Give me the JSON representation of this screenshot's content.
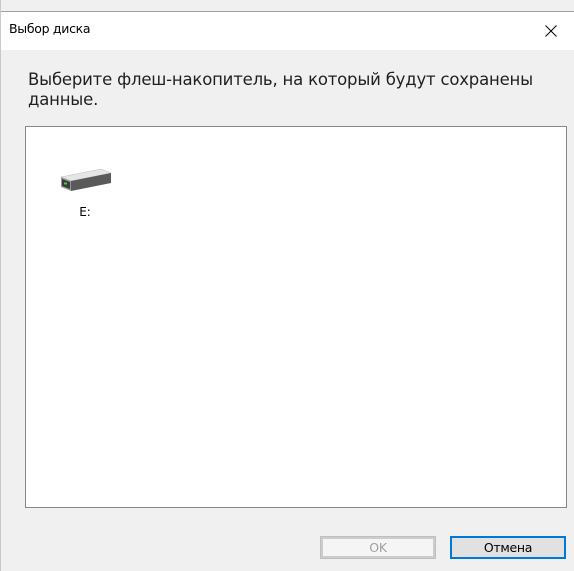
{
  "window": {
    "title": "Выбор диска"
  },
  "instruction": "Выберите флеш-накопитель, на который будут сохранены данные.",
  "drives": [
    {
      "label": "E:",
      "icon": "drive-icon"
    }
  ],
  "buttons": {
    "ok_label": "OK",
    "cancel_label": "Отмена"
  },
  "colors": {
    "dialog_bg": "#f0f0f0",
    "list_border": "#828790",
    "focus_accent": "#0078d7",
    "disabled_text": "#a0a0a0"
  }
}
